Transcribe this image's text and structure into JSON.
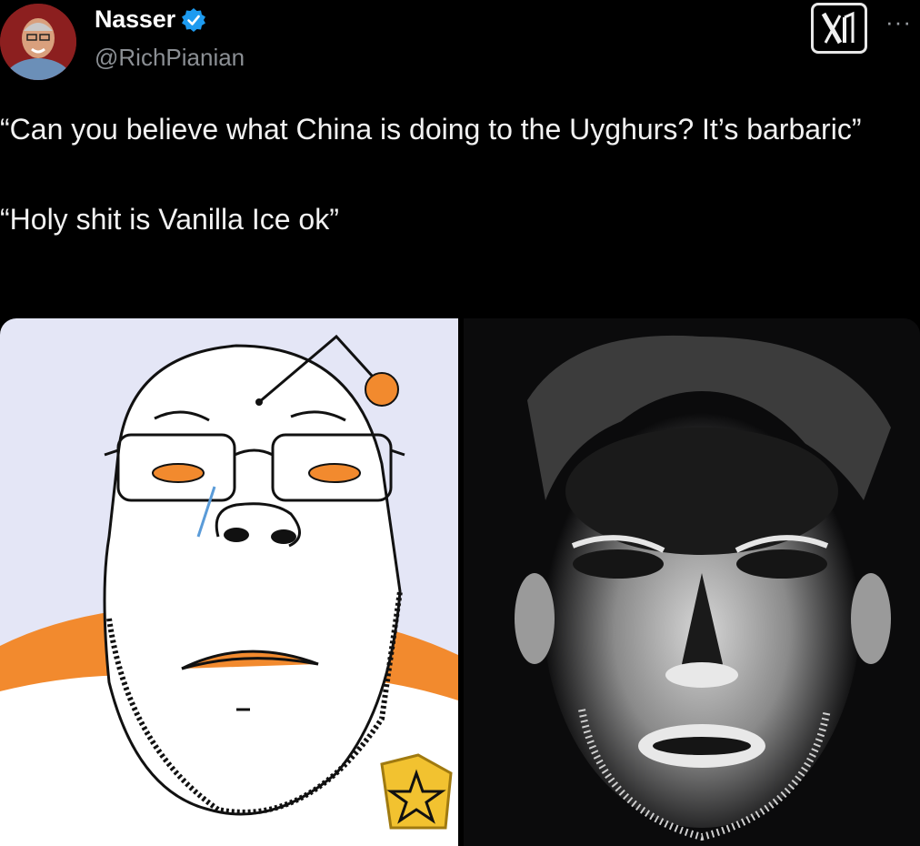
{
  "author": {
    "display_name": "Nasser",
    "handle": "@RichPianian",
    "verified_icon": "verified-badge-icon",
    "avatar_icon": "profile-avatar"
  },
  "header": {
    "logo_icon": "x-logo-icon",
    "more_label": "···"
  },
  "tweet": {
    "line1": "“Can you believe what China is doing to the Uyghurs? It’s barbaric”",
    "line2": "“Holy shit is Vanilla Ice ok”"
  },
  "media": {
    "left_image": "soyjak-cartoon-image",
    "right_image": "inverted-face-image"
  },
  "colors": {
    "background": "#000000",
    "text": "#f2f2f2",
    "handle": "#8b8f94",
    "verified": "#1d9bf0",
    "accent_orange": "#f28a2e"
  }
}
